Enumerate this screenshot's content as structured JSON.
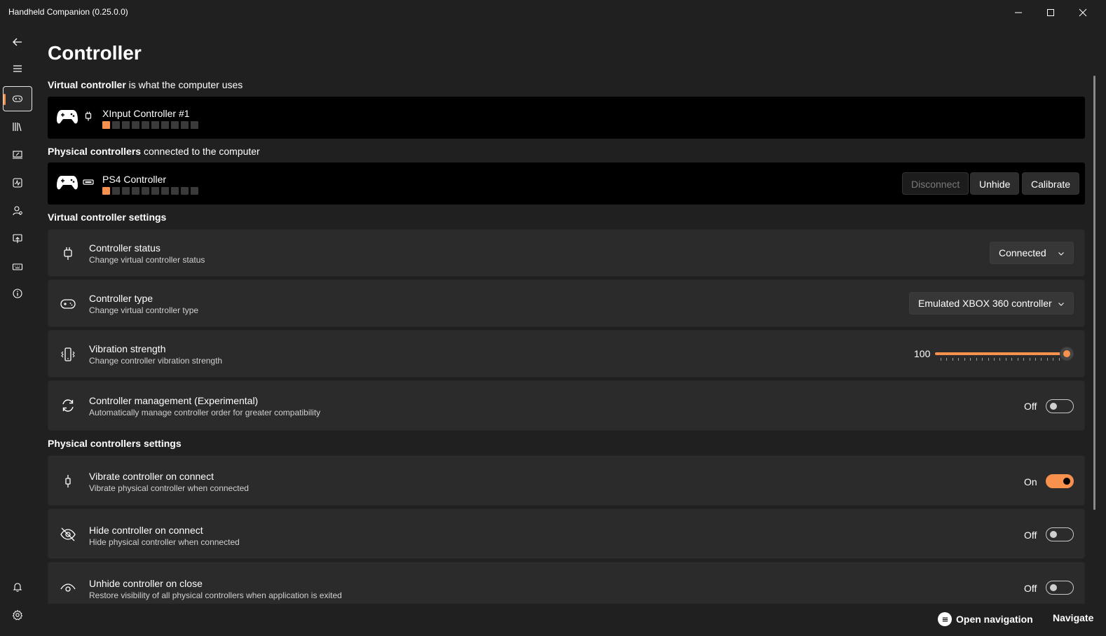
{
  "window": {
    "title": "Handheld Companion (0.25.0.0)"
  },
  "page": {
    "title": "Controller"
  },
  "virtual_section": {
    "bold": "Virtual controller",
    "rest": " is what the computer uses"
  },
  "virtual_controller": {
    "name": "XInput Controller #1",
    "slots_total": 10,
    "active_slot": 1
  },
  "physical_section": {
    "bold": "Physical controllers",
    "rest": " connected to the computer"
  },
  "physical_controller": {
    "name": "PS4 Controller",
    "slots_total": 10,
    "active_slot": 1,
    "buttons": {
      "disconnect": "Disconnect",
      "unhide": "Unhide",
      "calibrate": "Calibrate"
    }
  },
  "virtual_settings": {
    "header": "Virtual controller settings",
    "status": {
      "title": "Controller status",
      "desc": "Change virtual controller status",
      "value": "Connected"
    },
    "type": {
      "title": "Controller type",
      "desc": "Change virtual controller type",
      "value": "Emulated XBOX 360 controller"
    },
    "vibration": {
      "title": "Vibration strength",
      "desc": "Change controller vibration strength",
      "value": "100",
      "fraction": 1.0
    },
    "management": {
      "title": "Controller management (Experimental)",
      "desc": "Automatically manage controller order for greater compatibility",
      "state": "Off"
    }
  },
  "physical_settings": {
    "header": "Physical controllers settings",
    "vibrate": {
      "title": "Vibrate controller on connect",
      "desc": "Vibrate physical controller when connected",
      "state": "On"
    },
    "hide": {
      "title": "Hide controller on connect",
      "desc": "Hide physical controller when connected",
      "state": "Off"
    },
    "unhide": {
      "title": "Unhide controller on close",
      "desc": "Restore visibility of all physical controllers when application is exited",
      "state": "Off"
    }
  },
  "footer": {
    "open_navigation": "Open navigation",
    "navigate": "Navigate"
  },
  "colors": {
    "accent": "#f7914d",
    "background": "#202020",
    "card": "#2b2b2b"
  },
  "icons": {
    "nav": [
      "back-icon",
      "hamburger-icon",
      "controller-icon",
      "library-icon",
      "device-icon",
      "performance-icon",
      "profiles-icon",
      "overlay-icon",
      "hotkeys-icon",
      "about-icon",
      "notifications-icon",
      "settings-icon"
    ]
  }
}
